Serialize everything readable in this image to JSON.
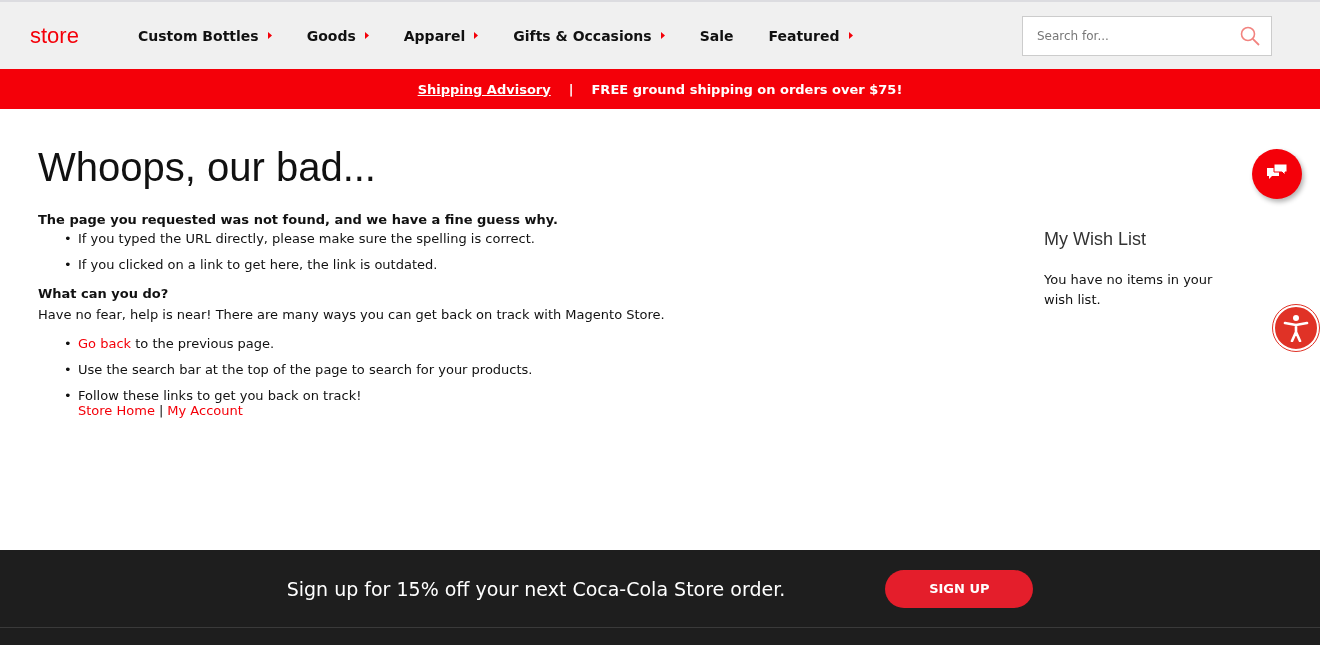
{
  "header": {
    "logo": "store",
    "nav": [
      {
        "label": "Custom Bottles",
        "has_menu": true
      },
      {
        "label": "Goods",
        "has_menu": true
      },
      {
        "label": "Apparel",
        "has_menu": true
      },
      {
        "label": "Gifts & Occasions",
        "has_menu": true
      },
      {
        "label": "Sale",
        "has_menu": false
      },
      {
        "label": "Featured",
        "has_menu": true
      }
    ],
    "search": {
      "placeholder": "Search for..."
    }
  },
  "banner": {
    "link": "Shipping Advisory",
    "separator": "|",
    "message": "FREE ground shipping on orders over $75!"
  },
  "main": {
    "title": "Whoops, our bad...",
    "reason_heading": "The page you requested was not found, and we have a fine guess why.",
    "reasons": [
      {
        "marker": "•",
        "text": "If you typed the URL directly, please make sure the spelling is correct."
      },
      {
        "marker": "•",
        "text": "If you clicked on a link to get here, the link is outdated."
      }
    ],
    "help_heading": "What can you do?",
    "help_intro": "Have no fear, help is near! There are many ways you can get back on track with Magento Store.",
    "help_items": [
      {
        "kind": "link_first",
        "marker": "•",
        "link": "Go back",
        "text": "to the previous page."
      },
      {
        "kind": "plain",
        "marker": "•",
        "text": "Use the search bar at the top of the page to search for your products."
      },
      {
        "kind": "links_below",
        "marker": "•",
        "text": "Follow these links to get you back on track!",
        "links": [
          "Store Home",
          "My Account"
        ],
        "separator": "|"
      }
    ]
  },
  "sidebar": {
    "title": "My Wish List",
    "empty_message": "You have no items in your wish list."
  },
  "footer": {
    "message": "Sign up for 15% off your next Coca-Cola Store order.",
    "button": "SIGN UP"
  }
}
